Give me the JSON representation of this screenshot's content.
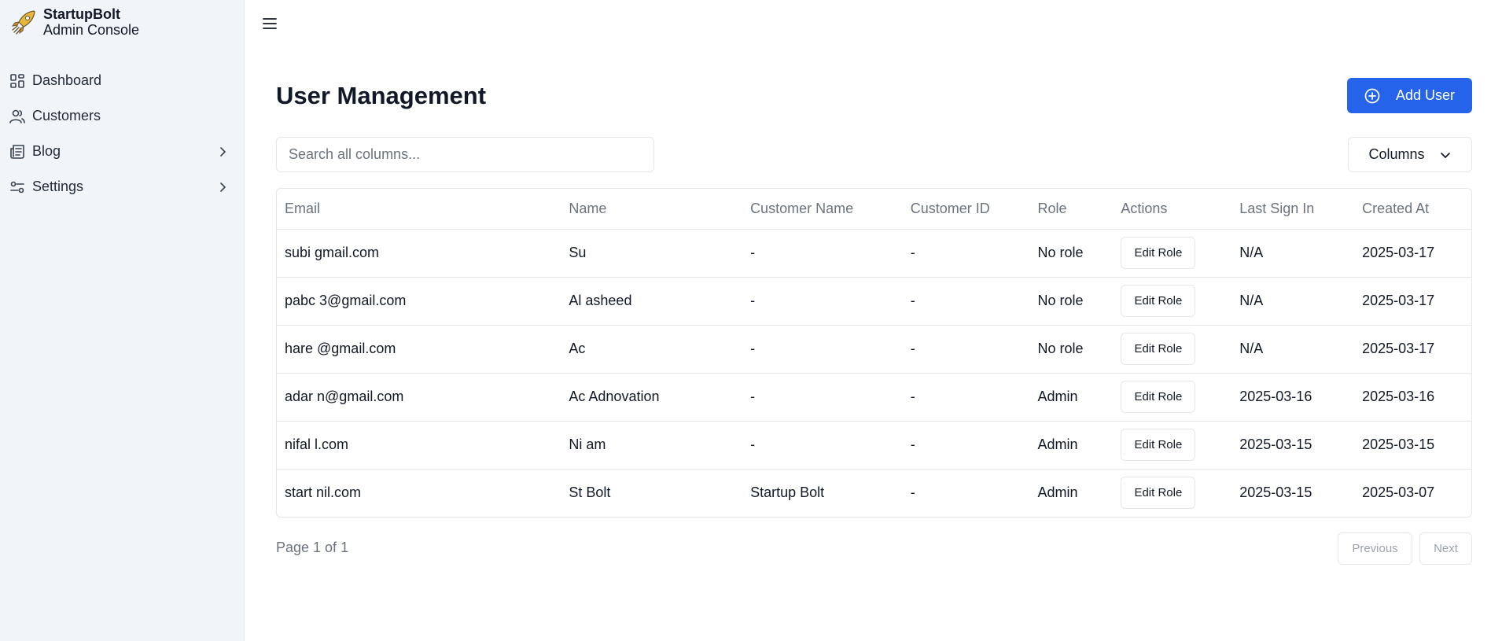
{
  "brand": {
    "name": "StartupBolt",
    "subtitle": "Admin Console"
  },
  "sidebar": {
    "items": [
      {
        "label": "Dashboard",
        "icon": "dashboard-icon",
        "has_chevron": false
      },
      {
        "label": "Customers",
        "icon": "users-icon",
        "has_chevron": false
      },
      {
        "label": "Blog",
        "icon": "newspaper-icon",
        "has_chevron": true
      },
      {
        "label": "Settings",
        "icon": "sliders-icon",
        "has_chevron": true
      }
    ]
  },
  "header": {
    "title": "User Management",
    "add_button_label": "Add User"
  },
  "search": {
    "placeholder": "Search all columns...",
    "value": ""
  },
  "columns_button_label": "Columns",
  "table": {
    "headers": [
      "Email",
      "Name",
      "Customer Name",
      "Customer ID",
      "Role",
      "Actions",
      "Last Sign In",
      "Created At"
    ],
    "action_label": "Edit Role",
    "rows": [
      {
        "email": "subi        gmail.com",
        "name": "Su",
        "customer_name": "-",
        "customer_id": "-",
        "role": "No role",
        "last_sign_in": "N/A",
        "created_at": "2025-03-17"
      },
      {
        "email": "pabc        3@gmail.com",
        "name": "Al       asheed",
        "customer_name": "-",
        "customer_id": "-",
        "role": "No role",
        "last_sign_in": "N/A",
        "created_at": "2025-03-17"
      },
      {
        "email": "hare        @gmail.com",
        "name": "Ac",
        "customer_name": "-",
        "customer_id": "-",
        "role": "No role",
        "last_sign_in": "N/A",
        "created_at": "2025-03-17"
      },
      {
        "email": "adar        n@gmail.com",
        "name": "Ac      Adnovation",
        "customer_name": "-",
        "customer_id": "-",
        "role": "Admin",
        "last_sign_in": "2025-03-16",
        "created_at": "2025-03-16"
      },
      {
        "email": "nifal        l.com",
        "name": "Ni       am",
        "customer_name": "-",
        "customer_id": "-",
        "role": "Admin",
        "last_sign_in": "2025-03-15",
        "created_at": "2025-03-15"
      },
      {
        "email": "start        nil.com",
        "name": "St       Bolt",
        "customer_name": "Startup Bolt",
        "customer_id": "-",
        "role": "Admin",
        "last_sign_in": "2025-03-15",
        "created_at": "2025-03-07"
      }
    ]
  },
  "pagination": {
    "text": "Page 1 of 1",
    "previous_label": "Previous",
    "next_label": "Next"
  },
  "colors": {
    "accent": "#2563eb",
    "sidebar_bg": "#f1f5fa",
    "border": "#e5e7eb",
    "muted_text": "#6b7280"
  }
}
